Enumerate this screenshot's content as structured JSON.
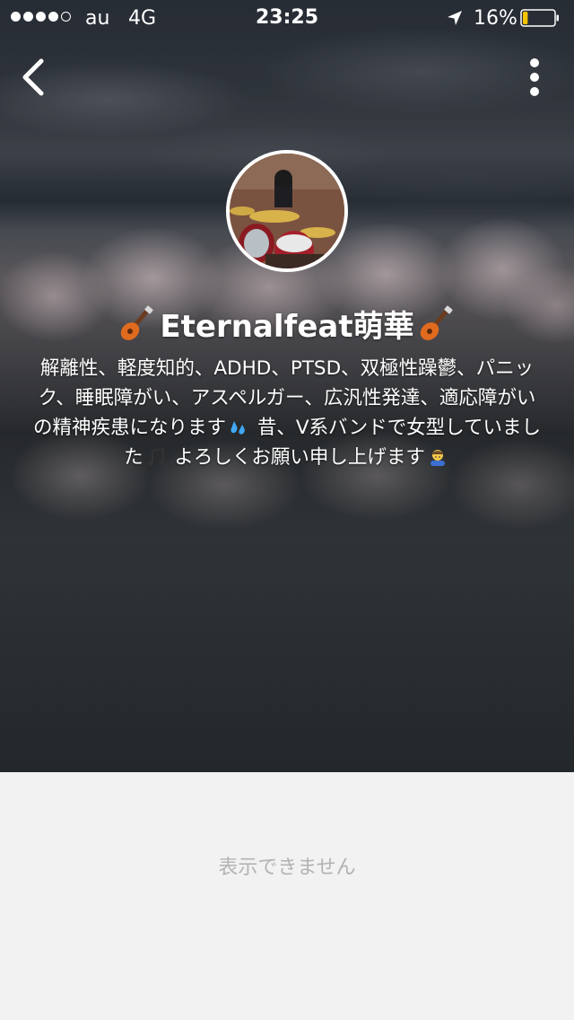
{
  "status_bar": {
    "carrier": "au",
    "network": "4G",
    "time": "23:25",
    "battery_percent": "16%",
    "battery_level": 0.16,
    "battery_color": "#f5c400",
    "signal_bars": 4,
    "signal_total": 5
  },
  "nav": {
    "back_icon": "chevron-left-icon",
    "more_icon": "vertical-ellipsis-icon"
  },
  "profile": {
    "name": "Eternalfeat萌華",
    "name_icon": "guitar-emoji",
    "bio_line1": "解離性、軽度知的、ADHD、PTSD、双極性躁鬱、パニック、睡眠障がい、アスペルガー、広汎性発達、適応障がいの精神疾患になります",
    "bio_line2": " 昔、V系バンドで女型していました",
    "bio_line3": " よろしくお願い申し上げます",
    "bio_emoji_1": "sweat-droplets-emoji",
    "bio_emoji_2": "musical-notes-emoji",
    "bio_emoji_3": "bowing-person-emoji"
  },
  "content": {
    "empty_message": "表示できません"
  },
  "colors": {
    "text_primary": "#ffffff",
    "empty_text": "#b3b3b3",
    "background": "#f2f2f2"
  }
}
